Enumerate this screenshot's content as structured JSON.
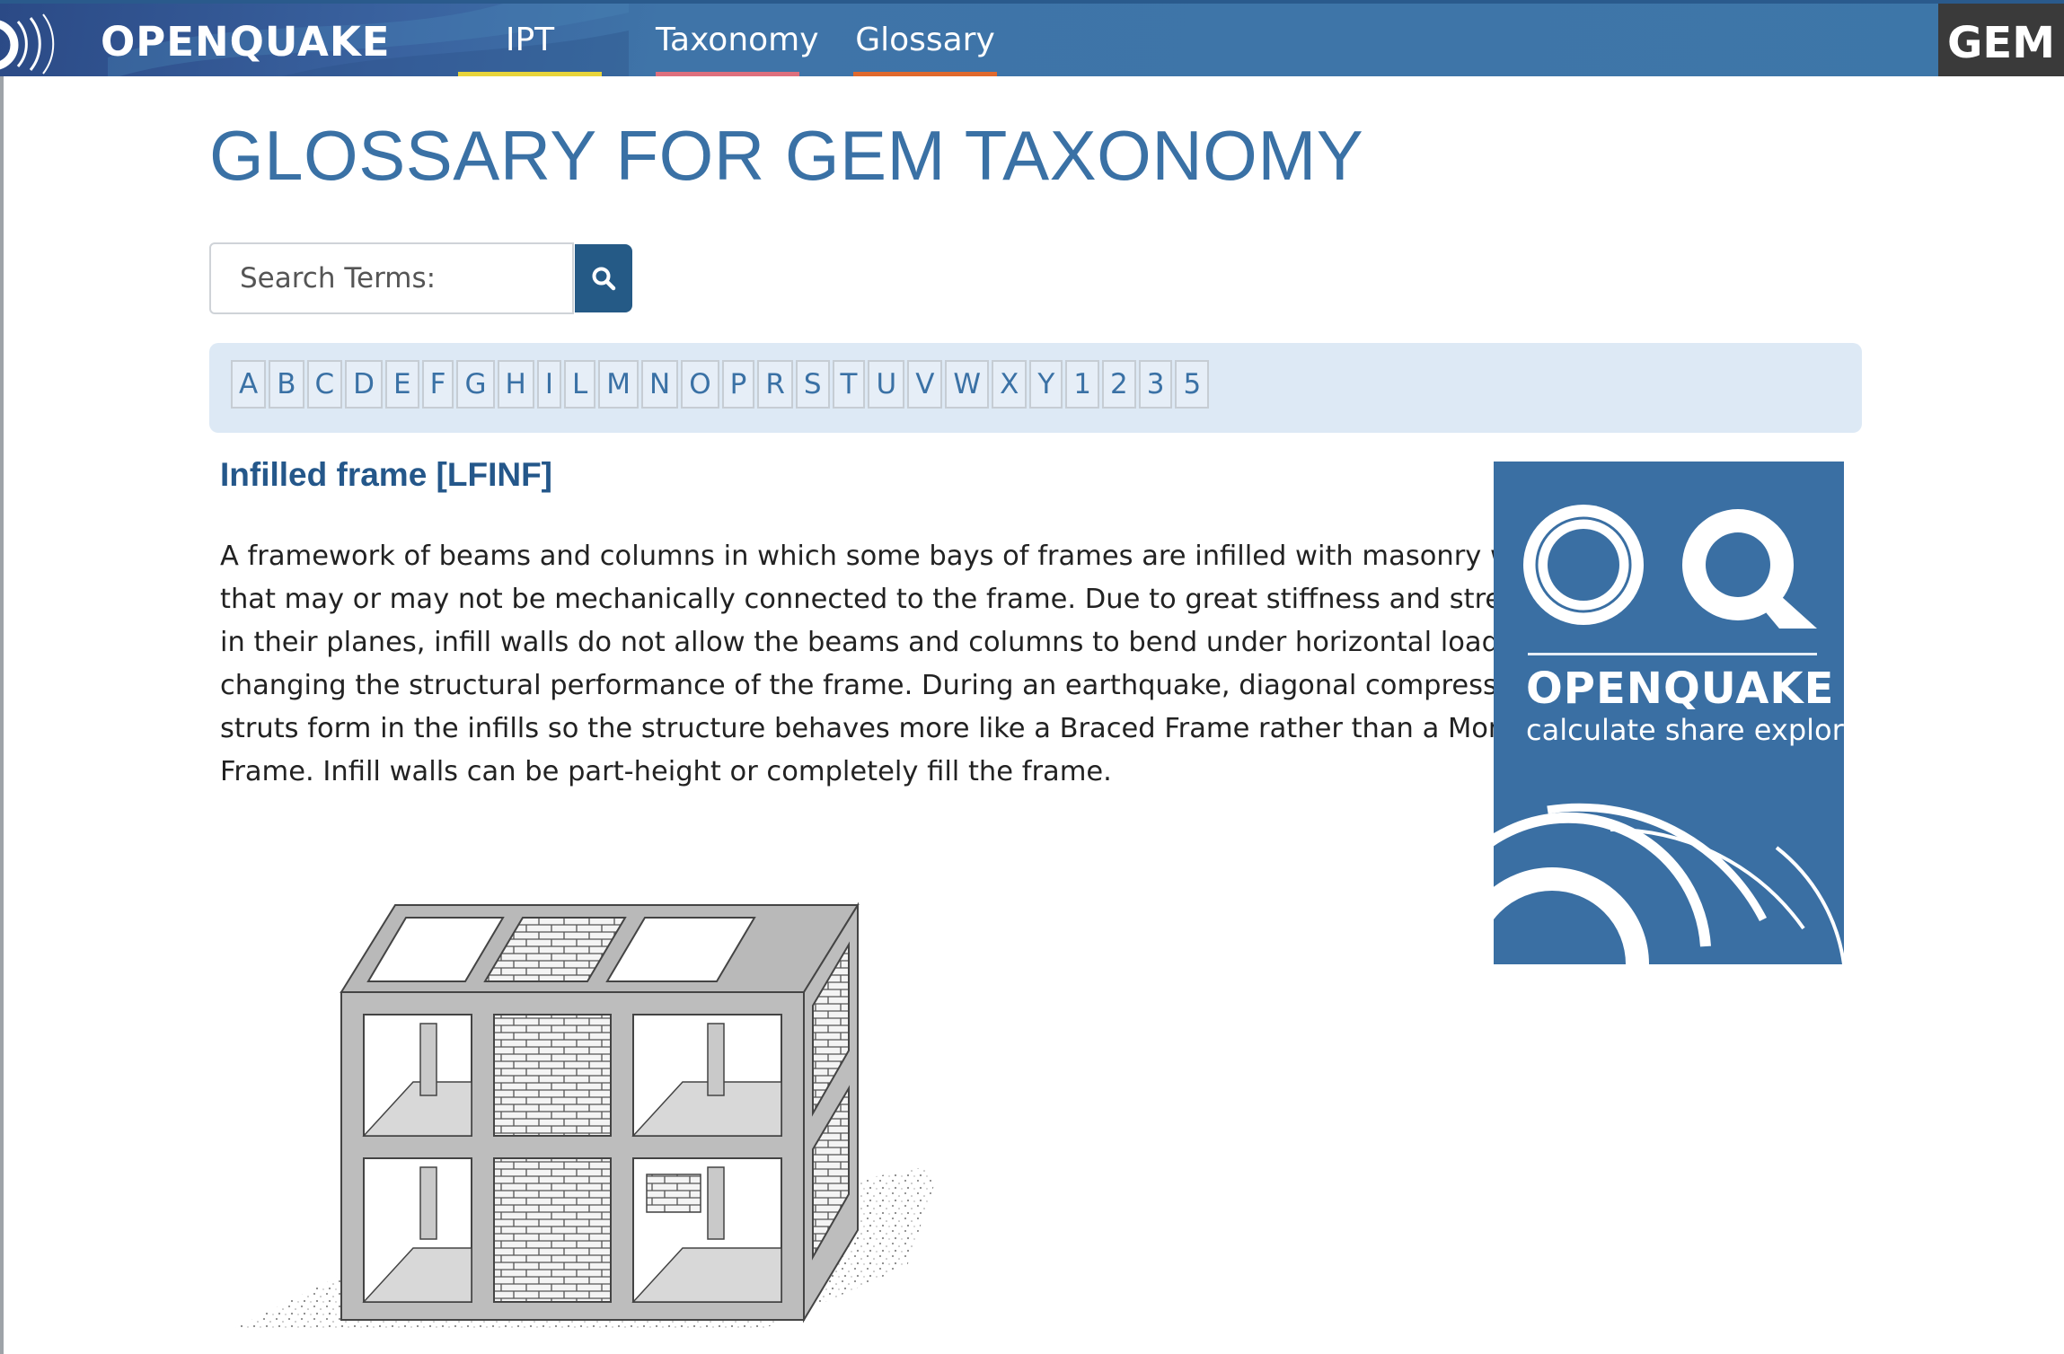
{
  "brand": {
    "name": "OPENQUAKE",
    "right_logo": "GEM"
  },
  "nav": {
    "items": [
      {
        "label": "IPT",
        "accent": "#e8d43a"
      },
      {
        "label": "Taxonomy",
        "accent": "#de6f7d"
      },
      {
        "label": "Glossary",
        "accent": "#e0692d"
      }
    ]
  },
  "page": {
    "title": "GLOSSARY FOR GEM TAXONOMY"
  },
  "search": {
    "placeholder": "Search Terms:",
    "value": "",
    "icon": "search-icon"
  },
  "alphabet": [
    "A",
    "B",
    "C",
    "D",
    "E",
    "F",
    "G",
    "H",
    "I",
    "L",
    "M",
    "N",
    "O",
    "P",
    "R",
    "S",
    "T",
    "U",
    "V",
    "W",
    "X",
    "Y",
    "1",
    "2",
    "3",
    "5"
  ],
  "entry": {
    "title": "Infilled frame [LFINF]",
    "lines": [
      "A framework of beams and columns in which some bays of frames are infilled with masonry walls",
      "that may or may not be mechanically connected to the frame. Due to great stiffness and strength",
      "in their planes, infill walls do not allow the beams and columns to bend under horizontal loading,",
      "changing the structural performance of the frame. During an earthquake, diagonal compression",
      "struts form in the infills so the structure behaves more like a Braced Frame rather than a Moment",
      "Frame. Infill walls can be part-height or completely fill the frame."
    ]
  },
  "side_logo": {
    "wordmark": "OPENQUAKE",
    "tagline": "calculate share explore"
  },
  "colors": {
    "nav_bg": "#3d76a8",
    "title": "#3a71a5",
    "entry_title": "#24578a",
    "search_button": "#255a86",
    "alpha_bar": "#dde9f5",
    "logo_panel": "#3a6fa3"
  }
}
